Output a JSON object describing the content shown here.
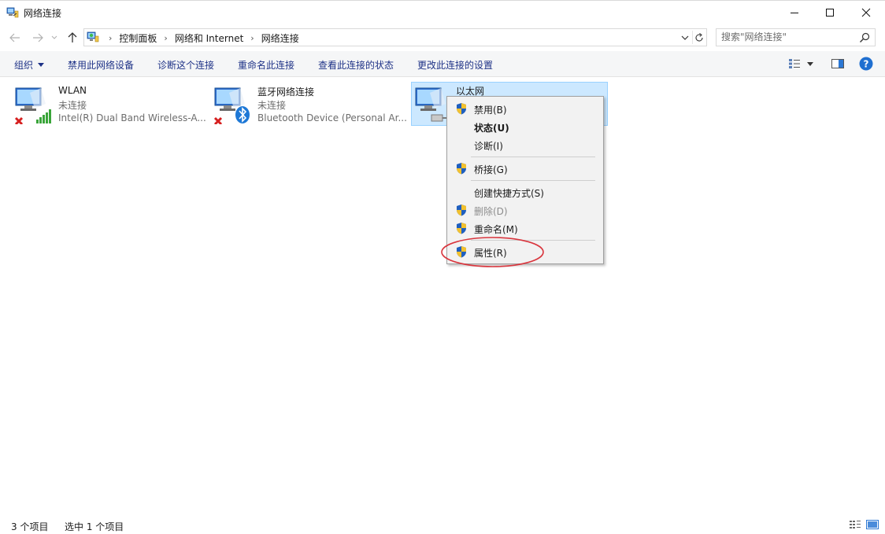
{
  "window": {
    "title": "网络连接",
    "minimize_icon": "minimize-icon",
    "maximize_icon": "maximize-icon",
    "close_icon": "close-icon"
  },
  "nav": {
    "breadcrumbs": [
      "控制面板",
      "网络和 Internet",
      "网络连接"
    ],
    "search_placeholder": "搜索\"网络连接\""
  },
  "commands": {
    "organize": "组织",
    "disable": "禁用此网络设备",
    "diagnose": "诊断这个连接",
    "rename": "重命名此连接",
    "view_status": "查看此连接的状态",
    "change_settings": "更改此连接的设置"
  },
  "connections": [
    {
      "name": "WLAN",
      "status": "未连接",
      "device": "Intel(R) Dual Band Wireless-A..."
    },
    {
      "name": "蓝牙网络连接",
      "status": "未连接",
      "device": "Bluetooth Device (Personal Ar..."
    },
    {
      "name": "以太网",
      "status": "",
      "device": ""
    }
  ],
  "context_menu": {
    "items": [
      {
        "label": "禁用(B)",
        "shield": true
      },
      {
        "label": "状态(U)",
        "bold": true
      },
      {
        "label": "诊断(I)"
      },
      {
        "label": "桥接(G)",
        "shield": true
      },
      {
        "label": "创建快捷方式(S)"
      },
      {
        "label": "删除(D)",
        "shield": true,
        "disabled": true
      },
      {
        "label": "重命名(M)",
        "shield": true
      },
      {
        "label": "属性(R)",
        "shield": true,
        "highlighted": true
      }
    ]
  },
  "statusbar": {
    "item_count": "3 个项目",
    "selected_count": "选中 1 个项目"
  },
  "colors": {
    "accent_link": "#1e3287",
    "selection_bg": "#cce8ff",
    "highlight_ring": "#d9363e",
    "help_blue": "#1f6fd0"
  }
}
